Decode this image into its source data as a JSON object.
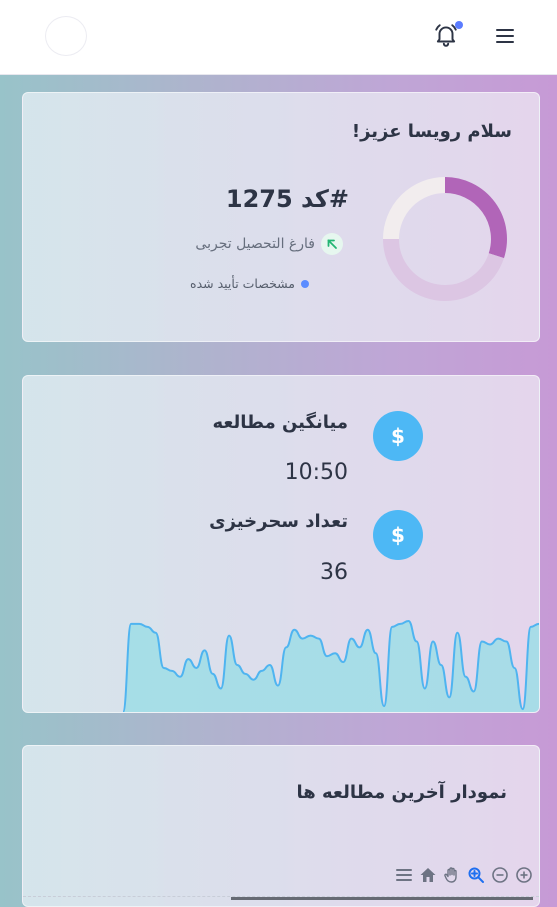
{
  "header": {
    "avatar_icon": "avatar",
    "bell_icon": "bell-icon",
    "notification_dot_color": "#5b7cff",
    "menu_icon": "hamburger-menu-icon"
  },
  "profile_card": {
    "greeting": "سلام رویسا عزیز!",
    "code": "#کد 1275",
    "status": "فارغ التحصیل تجربی",
    "status_icon": "arrow-up-left-icon",
    "verified": "مشخصات تأیید شده",
    "donut": {
      "segments": [
        {
          "value": 30,
          "color": "#b165b8"
        },
        {
          "value": 45,
          "color": "#dcc6e3"
        },
        {
          "value": 25,
          "color": "#f2edee"
        }
      ]
    }
  },
  "stats_card": {
    "avg_study_title": "میانگین مطالعه",
    "avg_study_value": "10:50",
    "wake_title": "تعداد سحرخیزی",
    "wake_value": "36",
    "icon_symbol": "$",
    "sparkline": [
      0,
      3,
      3,
      2.9,
      2.7,
      1.5,
      1.4,
      1.2,
      1.8,
      1.5,
      2.1,
      1.3,
      0.8,
      2.6,
      1.6,
      1.3,
      1.1,
      1.4,
      1.6,
      0.9,
      2.2,
      2.8,
      2.5,
      2.6,
      2.5,
      1.9,
      2.0,
      1.7,
      2.5,
      2.2,
      2.8,
      2.0,
      0.2,
      2.9,
      3.0,
      3.1,
      2.4,
      0.8,
      2.4,
      1.6,
      0.5,
      2.7,
      1.2,
      0.7,
      2.4,
      2.3,
      2.5,
      2.4,
      1.5,
      0.1,
      2.9,
      3.0
    ],
    "spark_color": "#4fb4f0",
    "spark_fill": "#9ddde6"
  },
  "chart_card": {
    "title": "نمودار آخرین مطالعه ها",
    "toolbar": [
      "zoom-in-icon",
      "zoom-out-icon",
      "magnify-icon",
      "pan-hand-icon",
      "home-icon",
      "menu-icon"
    ]
  }
}
